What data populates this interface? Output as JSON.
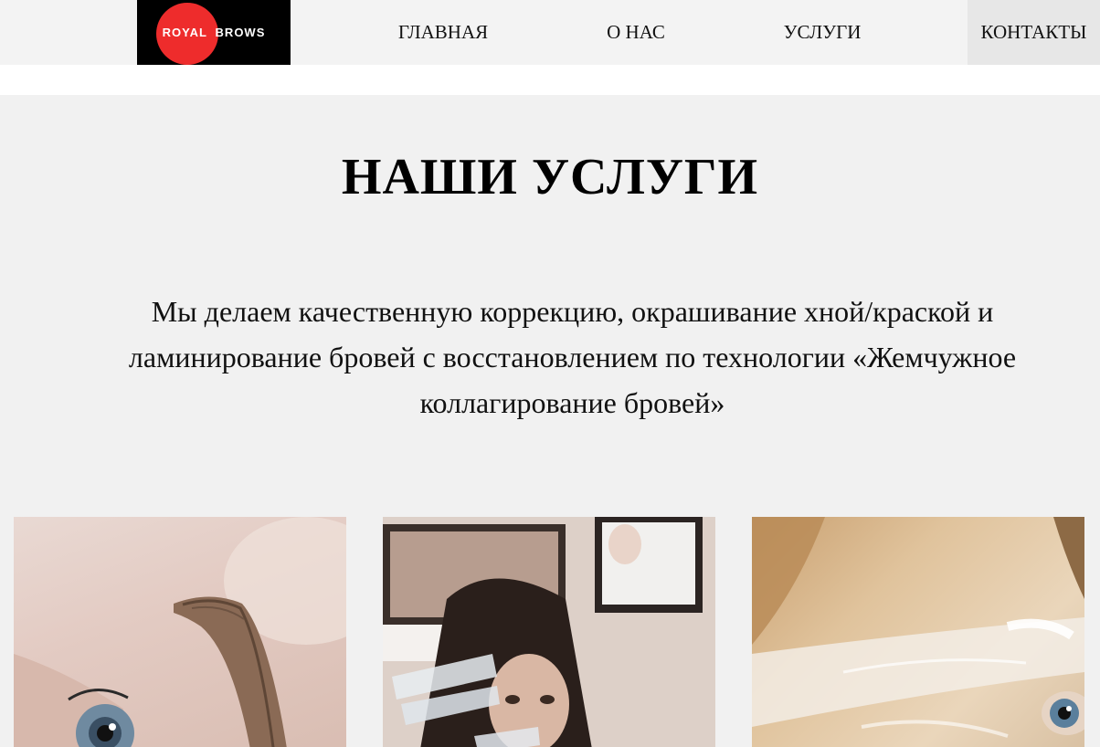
{
  "header": {
    "logo": {
      "word1": "ROYAL",
      "word2": "BROWS"
    },
    "nav": [
      {
        "label": "ГЛАВНАЯ"
      },
      {
        "label": "О НАС"
      },
      {
        "label": "УСЛУГИ"
      },
      {
        "label": "КОНТАКТЫ"
      }
    ]
  },
  "services": {
    "title": "НАШИ УСЛУГИ",
    "description": "Мы делаем качественную коррекцию, окрашивание хной/краской и ламинирование бровей с восстановлением по технологии «Жемчужное коллагирование бровей»",
    "cards": [
      {
        "image": "brow-closeup-photo"
      },
      {
        "image": "master-with-brushes-photo"
      },
      {
        "image": "brow-lamination-film-photo"
      }
    ]
  },
  "colors": {
    "header_bg": "#f3f3f3",
    "section_bg": "#f1f1f1",
    "logo_circle": "#ee2c2c",
    "active_nav_bg": "#e7e7e7"
  }
}
